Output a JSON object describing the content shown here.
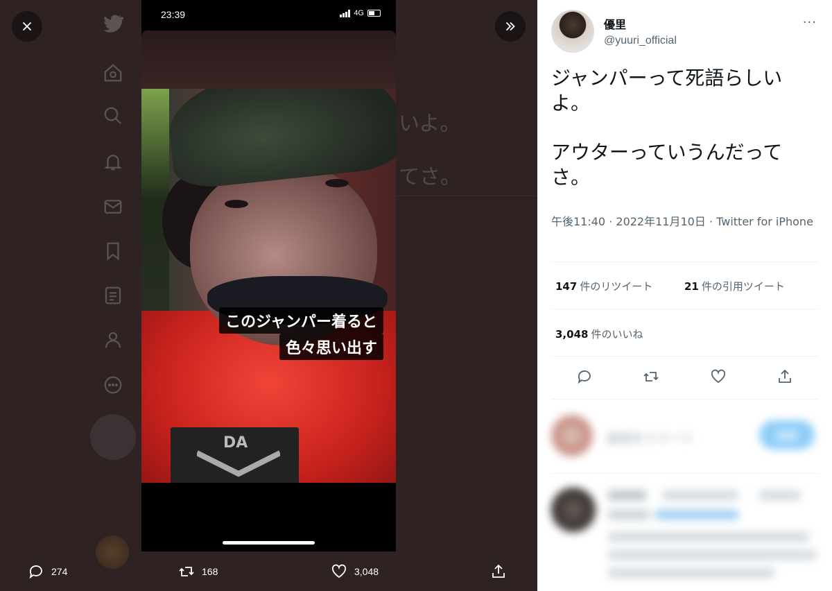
{
  "viewer": {
    "close_label": "×",
    "bg_text": [
      "いよ。",
      "てさ。"
    ],
    "phone": {
      "time": "23:39",
      "network": "4G",
      "caption_line1": "このジャンパー着ると",
      "caption_line2": "色々思い出す",
      "patch_text": "DA"
    },
    "actions": {
      "replies": "274",
      "retweets": "168",
      "likes": "3,048"
    }
  },
  "tweet": {
    "display_name": "優里",
    "handle": "@yuuri_official",
    "more_label": "···",
    "text_paragraph_1": "ジャンパーって死語らしいよ。",
    "text_paragraph_2": "アウターっていうんだってさ。",
    "time": "午後11:40",
    "date": "2022年11月10日",
    "source": "Twitter for iPhone",
    "retweets_count": "147",
    "retweets_label": "件のリツイート",
    "quotes_count": "21",
    "quotes_label": "件の引用ツイート",
    "likes_count": "3,048",
    "likes_label": "件のいいね"
  },
  "reply": {
    "placeholder": "返信をツイート",
    "button": "返信"
  }
}
